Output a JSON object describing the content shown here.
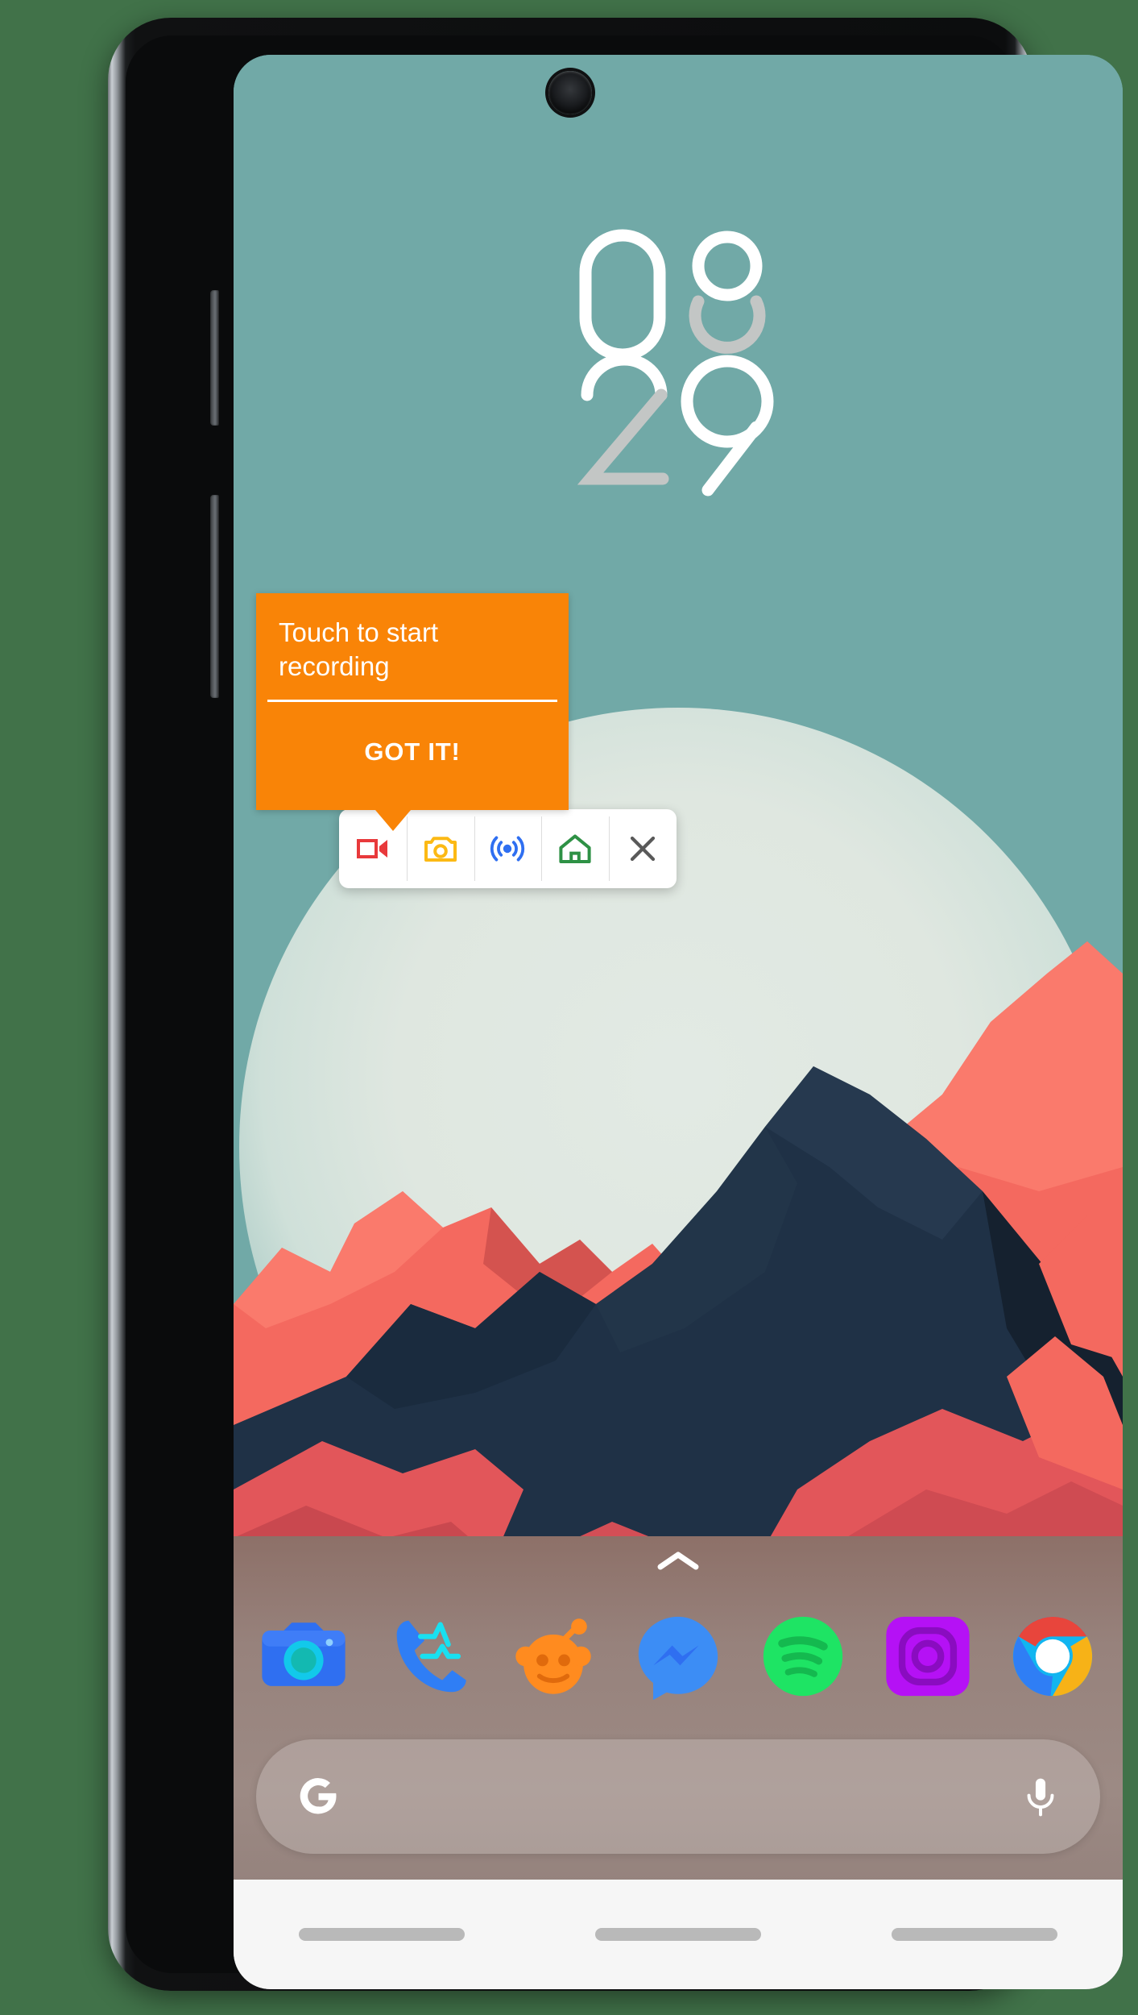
{
  "device": {
    "name": "android-phone",
    "camera": "front-camera-punch-hole"
  },
  "wallpaper": {
    "name": "low-poly-mountains",
    "sky_color": "#71a9a7",
    "sun_color": "#e2eae4",
    "mountain_light": "#f4695f",
    "mountain_dark": "#1f3146",
    "ground_color": "#97827c"
  },
  "clock_widget": {
    "name": "minimal-clock",
    "hours": "08",
    "minutes": "29",
    "time": "08:29",
    "active_color": "#ffffff",
    "inactive_color": "#c3c6c5"
  },
  "coach_tooltip": {
    "message": "Touch to start recording",
    "button_label": "GOT IT!",
    "background_color": "#f98407",
    "text_color": "#ffffff"
  },
  "floating_toolbar": {
    "name": "screen-recorder-toolbar",
    "buttons": [
      {
        "id": "record",
        "icon": "videocam-icon",
        "label": "Record",
        "color": "#e8393b"
      },
      {
        "id": "screenshot",
        "icon": "camera-icon",
        "label": "Screenshot",
        "color": "#fcb914"
      },
      {
        "id": "live",
        "icon": "broadcast-icon",
        "label": "Live",
        "color": "#2f6ff1"
      },
      {
        "id": "home",
        "icon": "home-icon",
        "label": "Home",
        "color": "#2e9145"
      },
      {
        "id": "close",
        "icon": "close-icon",
        "label": "Close",
        "color": "#595959"
      }
    ]
  },
  "app_drawer": {
    "handle_icon": "chevron-up-icon",
    "handle_color": "#ffffff"
  },
  "dock": {
    "apps": [
      {
        "id": "camera",
        "name": "Camera",
        "icon": "camera-app-icon",
        "color": "#2f6ff1"
      },
      {
        "id": "phone",
        "name": "Phone",
        "icon": "phone-app-icon",
        "color": "#2f7ef5"
      },
      {
        "id": "reddit",
        "name": "Reddit",
        "icon": "reddit-app-icon",
        "color": "#ff8b1f"
      },
      {
        "id": "messenger",
        "name": "Messenger",
        "icon": "messenger-app-icon",
        "color": "#3c8df5"
      },
      {
        "id": "spotify",
        "name": "Spotify",
        "icon": "spotify-app-icon",
        "color": "#1ee464"
      },
      {
        "id": "instagram",
        "name": "Instagram",
        "icon": "instagram-app-icon",
        "color": "#b511f5"
      },
      {
        "id": "chrome",
        "name": "Chrome",
        "icon": "chrome-app-icon",
        "color": "#e8453c"
      }
    ]
  },
  "search": {
    "name": "google-search-bar",
    "logo": "google-g-icon",
    "mic_icon": "microphone-icon",
    "value": "",
    "placeholder": ""
  },
  "nav_bar": {
    "items": [
      {
        "id": "recents",
        "label": "Recents",
        "icon": "nav-pill-icon"
      },
      {
        "id": "home",
        "label": "Home",
        "icon": "nav-pill-icon"
      },
      {
        "id": "back",
        "label": "Back",
        "icon": "nav-pill-icon"
      }
    ]
  }
}
